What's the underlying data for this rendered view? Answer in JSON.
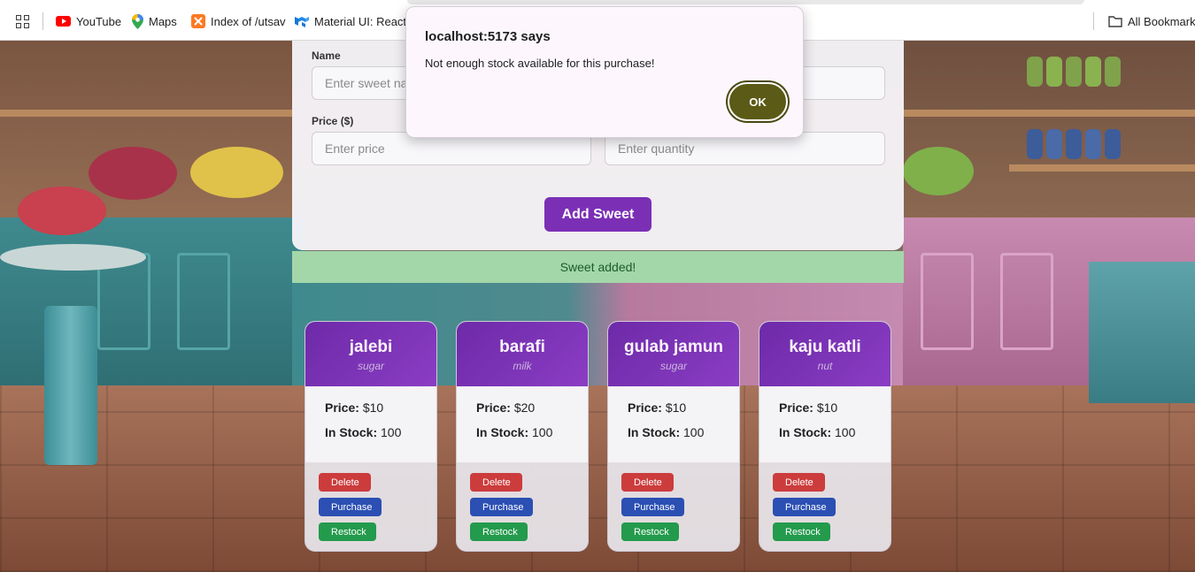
{
  "bookmarks": {
    "items": [
      {
        "label": "YouTube",
        "icon": "youtube-icon"
      },
      {
        "label": "Maps",
        "icon": "maps-icon"
      },
      {
        "label": "Index of /utsav",
        "icon": "xampp-icon"
      },
      {
        "label": "Material UI: React c",
        "icon": "mui-icon"
      }
    ],
    "all_bookmarks": "All Bookmarks"
  },
  "form": {
    "name_label": "Name",
    "name_placeholder": "Enter sweet na",
    "price_label": "Price ($)",
    "price_placeholder": "Enter price",
    "quantity_placeholder": "Enter quantity",
    "submit_label": "Add Sweet"
  },
  "toast": "Sweet added!",
  "sweets": [
    {
      "name": "jalebi",
      "category": "sugar",
      "price_label": "Price:",
      "price": "$10",
      "stock_label": "In Stock:",
      "stock": "100"
    },
    {
      "name": "barafi",
      "category": "milk",
      "price_label": "Price:",
      "price": "$20",
      "stock_label": "In Stock:",
      "stock": "100"
    },
    {
      "name": "gulab jamun",
      "category": "sugar",
      "price_label": "Price:",
      "price": "$10",
      "stock_label": "In Stock:",
      "stock": "100"
    },
    {
      "name": "kaju katli",
      "category": "nut",
      "price_label": "Price:",
      "price": "$10",
      "stock_label": "In Stock:",
      "stock": "100"
    }
  ],
  "card_actions": {
    "delete": "Delete",
    "purchase": "Purchase",
    "restock": "Restock"
  },
  "dialog": {
    "title": "localhost:5173 says",
    "message": "Not enough stock available for this purchase!",
    "ok": "OK"
  },
  "colors": {
    "accent": "#7b2fb5",
    "delete": "#cc3c3c",
    "purchase": "#2b4fb3",
    "restock": "#239a4c",
    "toast_bg": "#a3d7a9",
    "dialog_ok": "#5b5a16"
  }
}
